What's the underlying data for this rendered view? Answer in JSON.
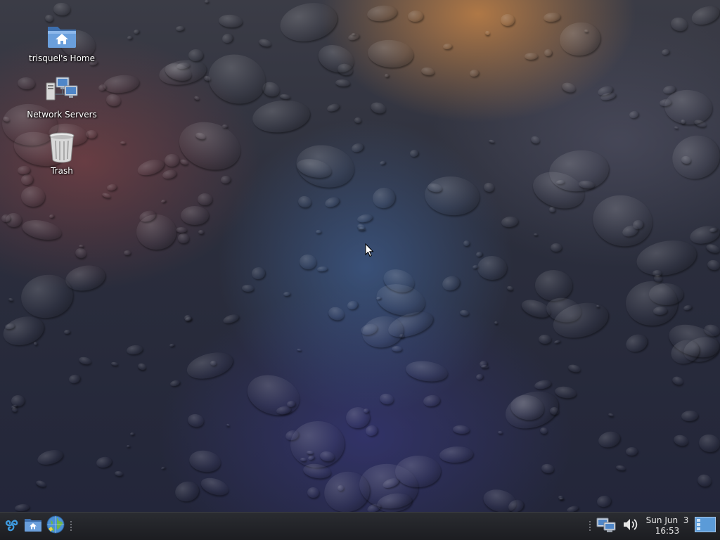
{
  "desktop": {
    "icons": [
      {
        "label": "trisquel's Home",
        "icon": "home-folder-icon"
      },
      {
        "label": "Network Servers",
        "icon": "network-servers-icon"
      },
      {
        "label": "Trash",
        "icon": "trash-icon"
      }
    ]
  },
  "taskbar": {
    "launchers": [
      {
        "name": "menu",
        "icon": "trisquel-menu-icon"
      },
      {
        "name": "file-manager",
        "icon": "home-folder-icon"
      },
      {
        "name": "web-browser",
        "icon": "globe-icon"
      }
    ],
    "tray": {
      "network_icon": "network-icon",
      "volume_icon": "volume-icon",
      "desktop_icon": "show-desktop-icon"
    },
    "clock": {
      "date": "Sun Jun  3",
      "time": "16:53"
    }
  },
  "colors": {
    "taskbar_bg": "#1c1d21",
    "folder_blue": "#5b8fd0",
    "menu_blue": "#3f9be0"
  }
}
